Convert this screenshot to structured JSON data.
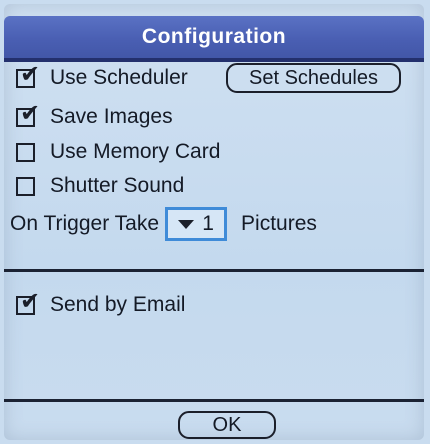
{
  "dialog": {
    "title": "Configuration"
  },
  "options": {
    "use_scheduler": {
      "label": "Use Scheduler",
      "checked": true
    },
    "save_images": {
      "label": "Save Images",
      "checked": true
    },
    "use_memory_card": {
      "label": "Use Memory Card",
      "checked": false
    },
    "shutter_sound": {
      "label": "Shutter Sound",
      "checked": false
    },
    "send_by_email": {
      "label": "Send by Email",
      "checked": true
    }
  },
  "buttons": {
    "set_schedules": "Set Schedules",
    "ok": "OK"
  },
  "trigger": {
    "prefix": "On Trigger Take",
    "value": "1",
    "suffix": "Pictures"
  },
  "icons": {
    "check": "checkmark-icon",
    "dropdown": "triangle-down-icon"
  },
  "colors": {
    "title_bar": "#4a5fb3",
    "background": "#c9dcef",
    "focus_ring": "#3f8bd8"
  }
}
